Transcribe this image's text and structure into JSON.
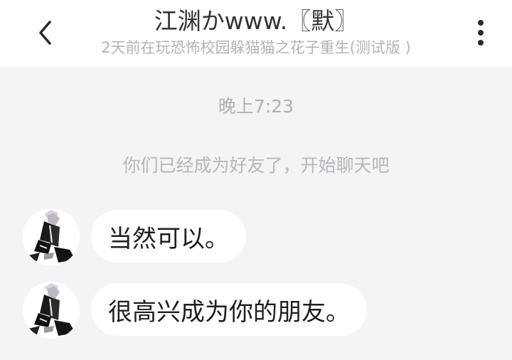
{
  "header": {
    "title": "江渊かwww.〖默〗",
    "subtitle": "2天前在玩恐怖校园躲猫猫之花子重生(测试版 )",
    "back_icon": "chevron-left-icon",
    "more_icon": "vertical-ellipsis-icon"
  },
  "chat": {
    "timestamp": "晚上7:23",
    "system_message": "你们已经成为好友了，开始聊天吧",
    "messages": [
      {
        "text": "当然可以。"
      },
      {
        "text": "很高兴成为你的朋友。"
      }
    ]
  },
  "colors": {
    "background": "#f4f4f6",
    "bubble": "#ffffff",
    "header": "#ffffff"
  }
}
